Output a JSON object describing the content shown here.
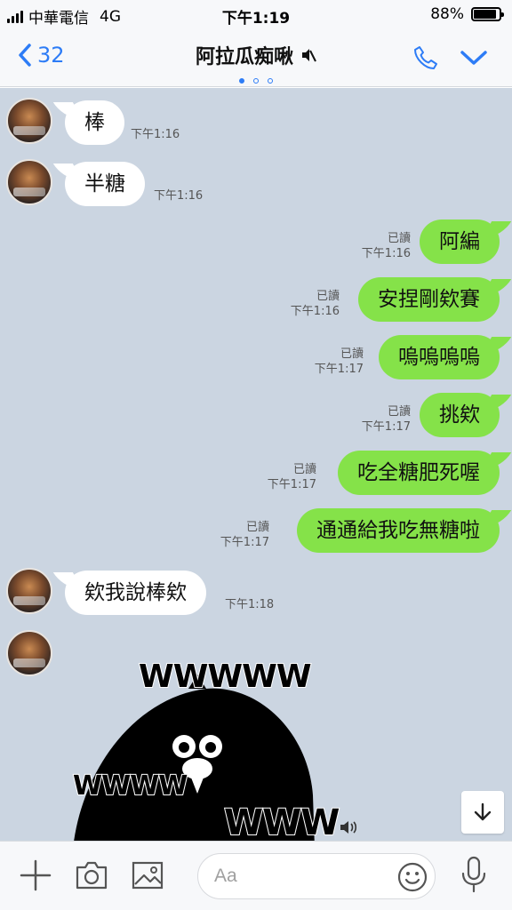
{
  "status": {
    "carrier": "中華電信",
    "network": "4G",
    "time": "下午1:19",
    "battery": "88%",
    "battery_level": 0.88
  },
  "header": {
    "back_count": "32",
    "title": "阿拉瓜痴啾",
    "page_dots": 3,
    "active_dot": 0
  },
  "messages": [
    {
      "dir": "in",
      "text": "棒",
      "time": "下午1:16"
    },
    {
      "dir": "in",
      "text": "半糖",
      "time": "下午1:16"
    },
    {
      "dir": "out",
      "text": "阿編",
      "read": "已讀",
      "time": "下午1:16"
    },
    {
      "dir": "out",
      "text": "安捏剛欸賽",
      "read": "已讀",
      "time": "下午1:16"
    },
    {
      "dir": "out",
      "text": "嗚嗚嗚嗚",
      "read": "已讀",
      "time": "下午1:17"
    },
    {
      "dir": "out",
      "text": "挑欸",
      "read": "已讀",
      "time": "下午1:17"
    },
    {
      "dir": "out",
      "text": "吃全糖肥死喔",
      "read": "已讀",
      "time": "下午1:17"
    },
    {
      "dir": "out",
      "text": "通通給我吃無糖啦",
      "read": "已讀",
      "time": "下午1:17"
    },
    {
      "dir": "in",
      "text": "欸我說棒欸",
      "time": "下午1:18"
    }
  ],
  "sticker": {
    "text_top": "WWWWW",
    "text_left": "WWWW",
    "text_bottom": "WWW"
  },
  "composer": {
    "placeholder": "Aa"
  },
  "colors": {
    "chat_bg": "#cbd5e1",
    "outgoing_bubble": "#85e249",
    "accent": "#2d7cf6"
  }
}
